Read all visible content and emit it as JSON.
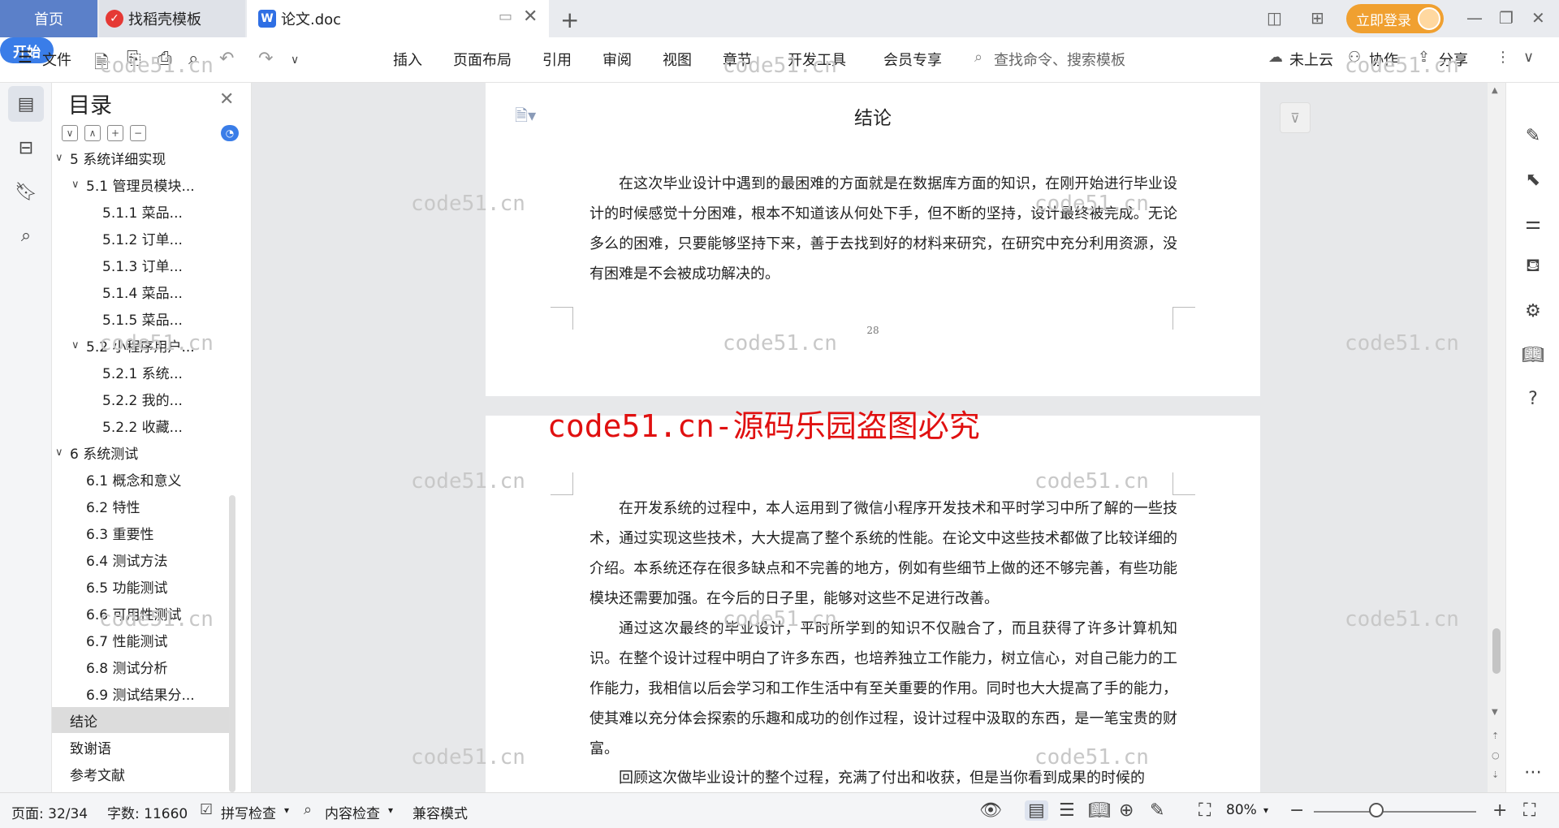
{
  "tabs": {
    "home": "首页",
    "templates": "找稻壳模板",
    "doc": "论文.doc"
  },
  "topbar": {
    "login": "立即登录"
  },
  "ribbon": {
    "file": "文件",
    "start": "开始",
    "insert": "插入",
    "layout": "页面布局",
    "reference": "引用",
    "review": "审阅",
    "view": "视图",
    "chapter": "章节",
    "developer": "开发工具",
    "member": "会员专享",
    "search": "查找命令、搜索模板",
    "cloud": "未上云",
    "collab": "协作",
    "share": "分享"
  },
  "toc": {
    "title": "目录",
    "items": [
      {
        "label": "5 系统详细实现",
        "level": 0,
        "arrow": "∨"
      },
      {
        "label": "5.1 管理员模块...",
        "level": 1,
        "arrow": "∨"
      },
      {
        "label": "5.1.1 菜品...",
        "level": 2,
        "arrow": ""
      },
      {
        "label": "5.1.2 订单...",
        "level": 2,
        "arrow": ""
      },
      {
        "label": "5.1.3 订单...",
        "level": 2,
        "arrow": ""
      },
      {
        "label": "5.1.4 菜品...",
        "level": 2,
        "arrow": ""
      },
      {
        "label": "5.1.5 菜品...",
        "level": 2,
        "arrow": ""
      },
      {
        "label": "5.2 小程序用户...",
        "level": 1,
        "arrow": "∨"
      },
      {
        "label": "5.2.1 系统...",
        "level": 2,
        "arrow": ""
      },
      {
        "label": "5.2.2 我的...",
        "level": 2,
        "arrow": ""
      },
      {
        "label": "5.2.2 收藏...",
        "level": 2,
        "arrow": ""
      },
      {
        "label": "6 系统测试",
        "level": 0,
        "arrow": "∨"
      },
      {
        "label": "6.1 概念和意义",
        "level": 1,
        "arrow": ""
      },
      {
        "label": "6.2 特性",
        "level": 1,
        "arrow": ""
      },
      {
        "label": "6.3 重要性",
        "level": 1,
        "arrow": ""
      },
      {
        "label": "6.4 测试方法",
        "level": 1,
        "arrow": ""
      },
      {
        "label": "6.5 功能测试",
        "level": 1,
        "arrow": ""
      },
      {
        "label": "6.6 可用性测试",
        "level": 1,
        "arrow": ""
      },
      {
        "label": "6.7 性能测试",
        "level": 1,
        "arrow": ""
      },
      {
        "label": "6.8 测试分析",
        "level": 1,
        "arrow": ""
      },
      {
        "label": "6.9 测试结果分...",
        "level": 1,
        "arrow": ""
      },
      {
        "label": "结论",
        "level": 0,
        "arrow": "",
        "active": true
      },
      {
        "label": "致谢语",
        "level": 0,
        "arrow": ""
      },
      {
        "label": "参考文献",
        "level": 0,
        "arrow": ""
      }
    ]
  },
  "document": {
    "heading": "结论",
    "page1_para": "在这次毕业设计中遇到的最困难的方面就是在数据库方面的知识，在刚开始进行毕业设计的时候感觉十分困难，根本不知道该从何处下手，但不断的坚持，设计最终被完成。无论多么的困难，只要能够坚持下来，善于去找到好的材料来研究，在研究中充分利用资源，没有困难是不会被成功解决的。",
    "page_number": "28",
    "page2_para1": "在开发系统的过程中，本人运用到了微信小程序开发技术和平时学习中所了解的一些技术，通过实现这些技术，大大提高了整个系统的性能。在论文中这些技术都做了比较详细的介绍。本系统还存在很多缺点和不完善的地方，例如有些细节上做的还不够完善，有些功能模块还需要加强。在今后的日子里，能够对这些不足进行改善。",
    "page2_para2": "通过这次最终的毕业设计，平时所学到的知识不仅融合了，而且获得了许多计算机知识。在整个设计过程中明白了许多东西，也培养独立工作能力，树立信心，对自己能力的工作能力，我相信以后会学习和工作生活中有至关重要的作用。同时也大大提高了手的能力，使其难以充分体会探索的乐趣和成功的创作过程，设计过程中汲取的东西，是一笔宝贵的财富。",
    "page2_para3": "回顾这次做毕业设计的整个过程，充满了付出和收获，但是当你看到成果的时候的"
  },
  "watermarks": {
    "small": "code51.cn",
    "red": "code51.cn-源码乐园盗图必究"
  },
  "statusbar": {
    "page": "页面: 32/34",
    "words": "字数: 11660",
    "spell": "拼写检查",
    "content_check": "内容检查",
    "compat": "兼容模式",
    "zoom": "80%"
  },
  "colors": {
    "home_tab": "#5b80c9",
    "accent_blue": "#3a7de8",
    "login_orange": "#f0a030",
    "watermark_red": "#e01010"
  }
}
